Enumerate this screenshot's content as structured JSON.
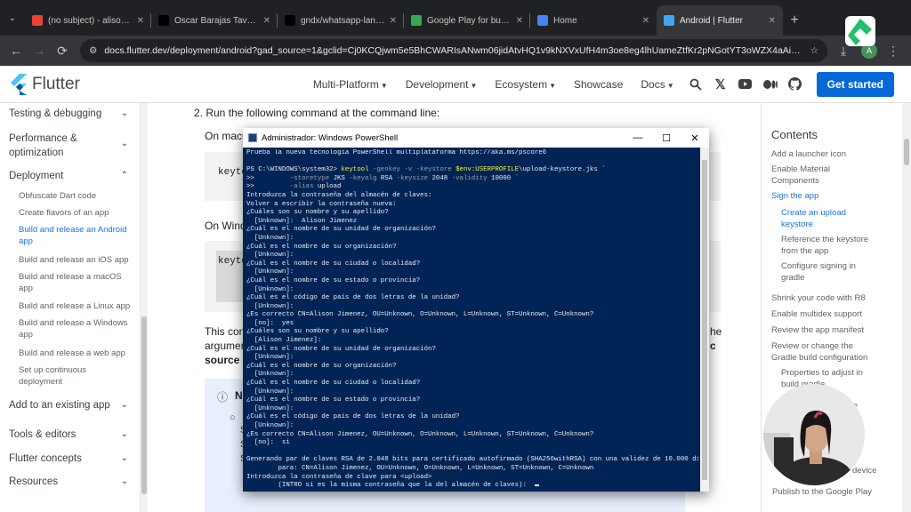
{
  "browser": {
    "tabs": [
      {
        "label": "(no subject) - alisonmelisa",
        "icon": "gmail-icon",
        "color": "#ea4335"
      },
      {
        "label": "Oscar Barajas Tavares @g",
        "icon": "x-icon",
        "color": "#000000"
      },
      {
        "label": "gndx/whatsapp-landing",
        "icon": "github-icon",
        "color": "#000000"
      },
      {
        "label": "Google Play for business",
        "icon": "google-play-icon",
        "color": "#34a853"
      },
      {
        "label": "Home",
        "icon": "flutter-icon",
        "color": "#4285f4"
      },
      {
        "label": "Android | Flutter",
        "icon": "flutter-icon",
        "color": "#42a5f5"
      }
    ],
    "url": "docs.flutter.dev/deployment/android?gad_source=1&gclid=Cj0KCQjwm5e5BhCWARIsANwm06jidAtvHQ1v9kNXVxUfH4m3oe8eg4lhUameZtfKr2pNGotYT3oWZX4aAiRaEALw_wcB&gclsrc=aw...",
    "profile_initial": "A"
  },
  "flutter_header": {
    "logo_text": "Flutter",
    "nav": [
      "Multi-Platform",
      "Development",
      "Ecosystem",
      "Showcase",
      "Docs"
    ],
    "cta": "Get started"
  },
  "sidebar": {
    "sections": [
      {
        "label": "Testing & debugging"
      },
      {
        "label": "Performance & optimization"
      },
      {
        "label": "Deployment"
      },
      {
        "label": "Add to an existing app"
      },
      {
        "label": "Tools & editors"
      },
      {
        "label": "Flutter concepts"
      },
      {
        "label": "Resources"
      }
    ],
    "deployment_items": [
      "Obfuscate Dart code",
      "Create flavors of an app",
      "Build and release an Android app",
      "Build and release an iOS app",
      "Build and release a macOS app",
      "Build and release a Linux app",
      "Build and release a Windows app",
      "Build and release a web app",
      "Set up continuous deployment"
    ]
  },
  "main": {
    "step": "2. Run the following command at the command line:",
    "on_mac": "On macO",
    "code1": "keyto",
    "on_windows": "On Windo",
    "code2": "keyto",
    "this_cmd": "This com",
    "argument": "argumen",
    "source_c": "source c",
    "right_frag": "he",
    "right_frag2": "c",
    "note_title": "N",
    "note_bullets": [
      "S",
      "S",
      "S"
    ]
  },
  "toc": {
    "title": "Contents",
    "items": [
      {
        "label": "Add a launcher icon",
        "sub": false,
        "active": false
      },
      {
        "label": "Enable Material Components",
        "sub": false,
        "active": false
      },
      {
        "label": "Sign the app",
        "sub": false,
        "active": true
      },
      {
        "label": "Create an upload keystore",
        "sub": true,
        "active": true
      },
      {
        "label": "Reference the keystore from the app",
        "sub": true,
        "active": false
      },
      {
        "label": "Configure signing in gradle",
        "sub": true,
        "active": false
      },
      {
        "label": "Shrink your code with R8",
        "sub": false,
        "active": false
      },
      {
        "label": "Enable multidex support",
        "sub": false,
        "active": false
      },
      {
        "label": "Review the app manifest",
        "sub": false,
        "active": false
      },
      {
        "label": "Review or change the Gradle build configuration",
        "sub": false,
        "active": false
      },
      {
        "label": "Properties to adjust in build.gradle",
        "sub": true,
        "active": false
      }
    ],
    "partial_se": "se",
    "device": "device",
    "publish": "Publish to the Google Play"
  },
  "powershell": {
    "title": "Administrador: Windows PowerShell",
    "lines": [
      [
        {
          "t": "Prueba la nueva tecnología PowerShell multiplataforma https://aka.ms/pscore6",
          "c": "white"
        }
      ],
      [
        {
          "t": "",
          "c": "white"
        }
      ],
      [
        {
          "t": "PS C:\\WINDOWS\\system32> ",
          "c": "white"
        },
        {
          "t": "keytool ",
          "c": "yellow"
        },
        {
          "t": "-genkey -v -keystore ",
          "c": "gray"
        },
        {
          "t": "$env:USERPROFILE",
          "c": "yellow"
        },
        {
          "t": "\\upload-keystore.jks `",
          "c": "white"
        }
      ],
      [
        {
          "t": ">>         ",
          "c": "white"
        },
        {
          "t": "-storetype ",
          "c": "gray"
        },
        {
          "t": "JKS ",
          "c": "white"
        },
        {
          "t": "-keyalg ",
          "c": "gray"
        },
        {
          "t": "RSA ",
          "c": "white"
        },
        {
          "t": "-keysize ",
          "c": "gray"
        },
        {
          "t": "2048 ",
          "c": "white"
        },
        {
          "t": "-validity ",
          "c": "gray"
        },
        {
          "t": "10000 `",
          "c": "white"
        }
      ],
      [
        {
          "t": ">>         ",
          "c": "white"
        },
        {
          "t": "-alias ",
          "c": "gray"
        },
        {
          "t": "upload",
          "c": "white"
        }
      ],
      [
        {
          "t": "Introduzca la contraseña del almacén de claves:",
          "c": "white"
        }
      ],
      [
        {
          "t": "Volver a escribir la contraseña nueva:",
          "c": "white"
        }
      ],
      [
        {
          "t": "¿Cuáles son su nombre y su apellido?",
          "c": "white"
        }
      ],
      [
        {
          "t": "  [Unknown]:  Alison Jimenez",
          "c": "white"
        }
      ],
      [
        {
          "t": "¿Cuál es el nombre de su unidad de organización?",
          "c": "white"
        }
      ],
      [
        {
          "t": "  [Unknown]:",
          "c": "white"
        }
      ],
      [
        {
          "t": "¿Cuál es el nombre de su organización?",
          "c": "white"
        }
      ],
      [
        {
          "t": "  [Unknown]:",
          "c": "white"
        }
      ],
      [
        {
          "t": "¿Cuál es el nombre de su ciudad o localidad?",
          "c": "white"
        }
      ],
      [
        {
          "t": "  [Unknown]:",
          "c": "white"
        }
      ],
      [
        {
          "t": "¿Cuál es el nombre de su estado o provincia?",
          "c": "white"
        }
      ],
      [
        {
          "t": "  [Unknown]:",
          "c": "white"
        }
      ],
      [
        {
          "t": "¿Cuál es el código de país de dos letras de la unidad?",
          "c": "white"
        }
      ],
      [
        {
          "t": "  [Unknown]:",
          "c": "white"
        }
      ],
      [
        {
          "t": "¿Es correcto CN=Alison Jimenez, OU=Unknown, O=Unknown, L=Unknown, ST=Unknown, C=Unknown?",
          "c": "white"
        }
      ],
      [
        {
          "t": "  [no]:  yes",
          "c": "white"
        }
      ],
      [
        {
          "t": "¿Cuáles son su nombre y su apellido?",
          "c": "white"
        }
      ],
      [
        {
          "t": "  [Alison Jimenez]:",
          "c": "white"
        }
      ],
      [
        {
          "t": "¿Cuál es el nombre de su unidad de organización?",
          "c": "white"
        }
      ],
      [
        {
          "t": "  [Unknown]:",
          "c": "white"
        }
      ],
      [
        {
          "t": "¿Cuál es el nombre de su organización?",
          "c": "white"
        }
      ],
      [
        {
          "t": "  [Unknown]:",
          "c": "white"
        }
      ],
      [
        {
          "t": "¿Cuál es el nombre de su ciudad o localidad?",
          "c": "white"
        }
      ],
      [
        {
          "t": "  [Unknown]:",
          "c": "white"
        }
      ],
      [
        {
          "t": "¿Cuál es el nombre de su estado o provincia?",
          "c": "white"
        }
      ],
      [
        {
          "t": "  [Unknown]:",
          "c": "white"
        }
      ],
      [
        {
          "t": "¿Cuál es el código de país de dos letras de la unidad?",
          "c": "white"
        }
      ],
      [
        {
          "t": "  [Unknown]:",
          "c": "white"
        }
      ],
      [
        {
          "t": "¿Es correcto CN=Alison Jimenez, OU=Unknown, O=Unknown, L=Unknown, ST=Unknown, C=Unknown?",
          "c": "white"
        }
      ],
      [
        {
          "t": "  [no]:  si",
          "c": "white"
        }
      ],
      [
        {
          "t": "",
          "c": "white"
        }
      ],
      [
        {
          "t": "Generando par de claves RSA de 2.048 bits para certificado autofirmado (SHA256withRSA) con una validez de 10.000 días",
          "c": "white"
        }
      ],
      [
        {
          "t": "        para: CN=Alison Jimenez, OU=Unknown, O=Unknown, L=Unknown, ST=Unknown, C=Unknown",
          "c": "white"
        }
      ],
      [
        {
          "t": "Introduzca la contraseña de clave para <upload>",
          "c": "white"
        }
      ],
      [
        {
          "t": "        (INTRO si es la misma contraseña que la del almacén de claves):  ",
          "c": "white"
        }
      ]
    ]
  },
  "colors": {
    "flutter_blue": "#0468d7",
    "powershell_bg": "#012456",
    "link_blue": "#1a73e8"
  }
}
